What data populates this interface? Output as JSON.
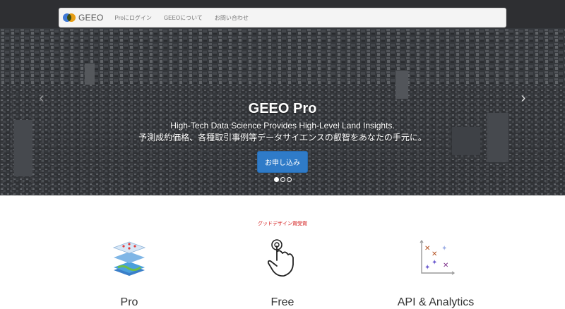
{
  "navbar": {
    "brand": "GEEO",
    "links": [
      "Proにログイン",
      "GEEOについて",
      "お問い合わせ"
    ]
  },
  "hero": {
    "title": "GEEO Pro",
    "subtitle_en": "High-Tech Data Science Provides High-Level Land Insights.",
    "subtitle_ja": "予測成約価格、各種取引事例等データサイエンスの叡智をあなたの手元に。",
    "cta_label": "お申し込み",
    "prev_icon": "chevron-left-icon",
    "next_icon": "chevron-right-icon",
    "slide_count": 3,
    "active_slide": 1
  },
  "award": "グッドデザイン賞受賞",
  "features": [
    {
      "title": "Pro",
      "icon": "map-layers-icon"
    },
    {
      "title": "Free",
      "icon": "hand-tap-icon"
    },
    {
      "title": "API & Analytics",
      "icon": "scatter-plot-icon"
    }
  ],
  "colors": {
    "accent": "#2f7bc8",
    "award_red": "#d42020",
    "logo_blue": "#3f79d6",
    "logo_orange": "#f2a516"
  }
}
